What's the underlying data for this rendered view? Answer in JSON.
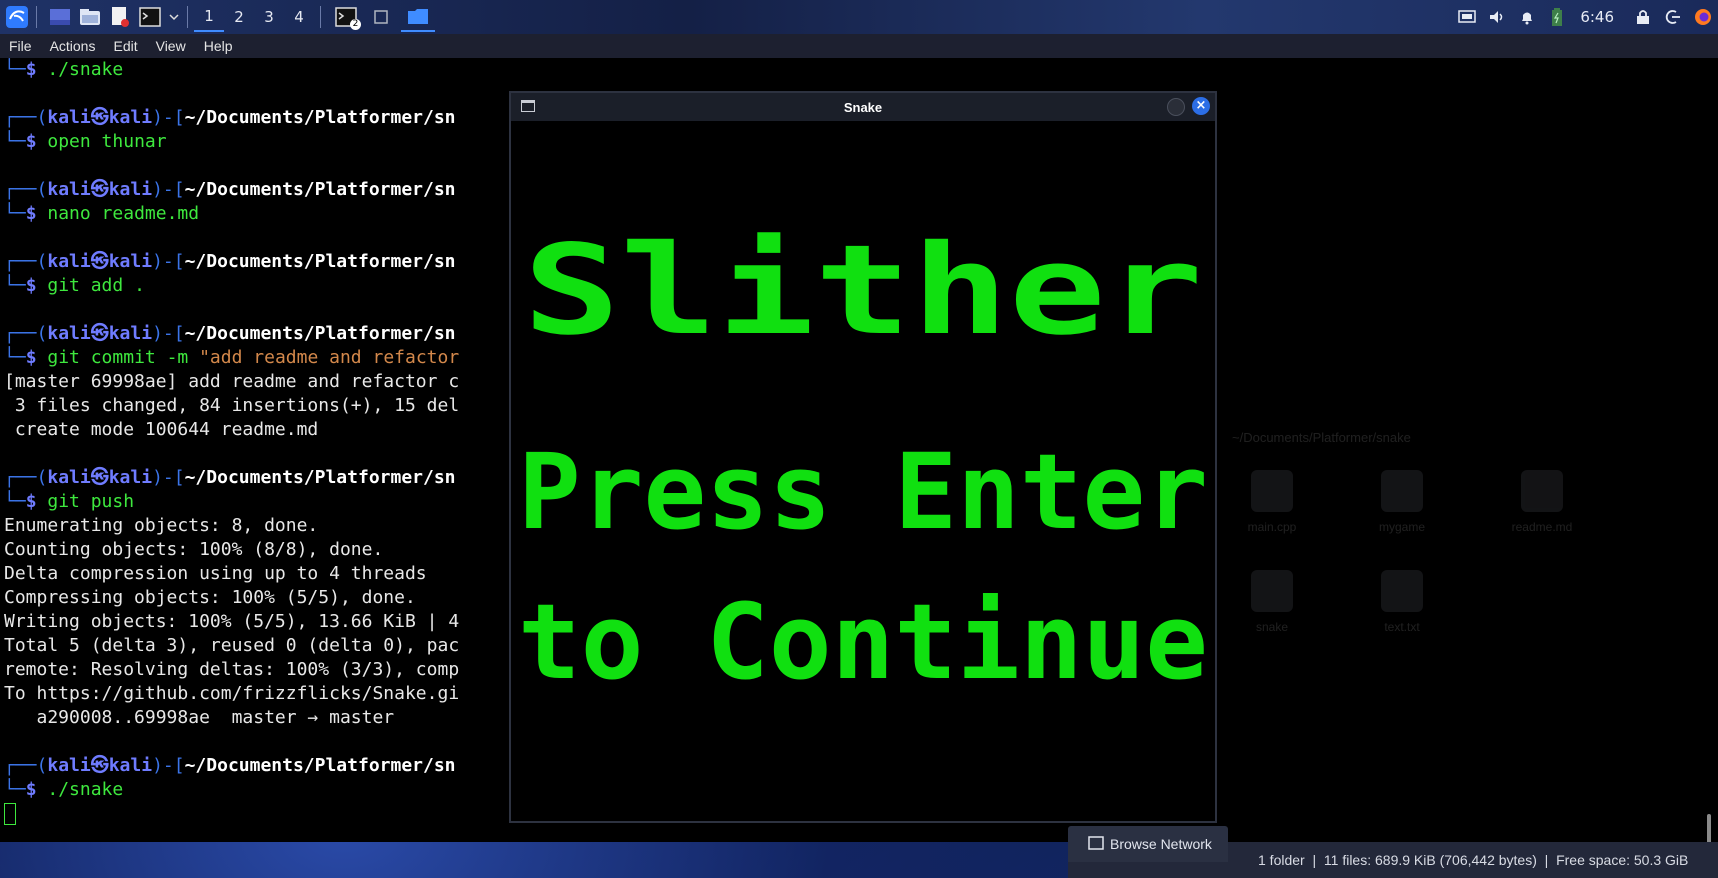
{
  "taskbar": {
    "workspaces": [
      "1",
      "2",
      "3",
      "4"
    ],
    "terminal_badge": "2",
    "clock": "6:46"
  },
  "terminal": {
    "menu": [
      "File",
      "Actions",
      "Edit",
      "View",
      "Help"
    ],
    "lines": [
      {
        "type": "cmd",
        "cmd": "./snake"
      },
      {
        "type": "blank"
      },
      {
        "type": "prompt",
        "user": "kali",
        "host": "kali",
        "path": "~/Documents/Platformer/sn"
      },
      {
        "type": "cmd",
        "cmd": "open thunar"
      },
      {
        "type": "blank"
      },
      {
        "type": "prompt",
        "user": "kali",
        "host": "kali",
        "path": "~/Documents/Platformer/sn"
      },
      {
        "type": "cmd",
        "cmd": "nano readme.md"
      },
      {
        "type": "blank"
      },
      {
        "type": "prompt",
        "user": "kali",
        "host": "kali",
        "path": "~/Documents/Platformer/sn"
      },
      {
        "type": "cmd",
        "cmd": "git add ."
      },
      {
        "type": "blank"
      },
      {
        "type": "prompt",
        "user": "kali",
        "host": "kali",
        "path": "~/Documents/Platformer/sn"
      },
      {
        "type": "cmd",
        "cmd": "git commit -m ",
        "arg": "\"add readme and refactor"
      },
      {
        "type": "out",
        "text": "[master 69998ae] add readme and refactor c"
      },
      {
        "type": "out",
        "text": " 3 files changed, 84 insertions(+), 15 del"
      },
      {
        "type": "out",
        "text": " create mode 100644 readme.md"
      },
      {
        "type": "blank"
      },
      {
        "type": "prompt",
        "user": "kali",
        "host": "kali",
        "path": "~/Documents/Platformer/sn"
      },
      {
        "type": "cmd",
        "cmd": "git push"
      },
      {
        "type": "out",
        "text": "Enumerating objects: 8, done."
      },
      {
        "type": "out",
        "text": "Counting objects: 100% (8/8), done."
      },
      {
        "type": "out",
        "text": "Delta compression using up to 4 threads"
      },
      {
        "type": "out",
        "text": "Compressing objects: 100% (5/5), done."
      },
      {
        "type": "out",
        "text": "Writing objects: 100% (5/5), 13.66 KiB | 4"
      },
      {
        "type": "out",
        "text": "Total 5 (delta 3), reused 0 (delta 0), pac"
      },
      {
        "type": "out",
        "text": "remote: Resolving deltas: 100% (3/3), comp"
      },
      {
        "type": "out",
        "text": "To https://github.com/frizzflicks/Snake.gi"
      },
      {
        "type": "out",
        "text": "   a290008..69998ae  master → master"
      },
      {
        "type": "blank"
      },
      {
        "type": "prompt",
        "user": "kali",
        "host": "kali",
        "path": "~/Documents/Platformer/sn"
      },
      {
        "type": "cmd",
        "cmd": "./snake"
      },
      {
        "type": "cursor"
      }
    ]
  },
  "snake_window": {
    "title": "Snake",
    "game_title": "Slither",
    "prompt_line1": "Press Enter",
    "prompt_line2": "to Continue",
    "text_color": "#10e010"
  },
  "file_manager": {
    "breadcrumb": "~/Documents/Platformer/snake",
    "files": [
      "main.cpp",
      "mygame",
      "readme.md",
      "snake",
      "text.txt"
    ],
    "browse_network": "Browse Network",
    "status": "1 folder  |  11 files: 689.9 KiB (706,442 bytes)  |  Free space: 50.3 GiB"
  }
}
